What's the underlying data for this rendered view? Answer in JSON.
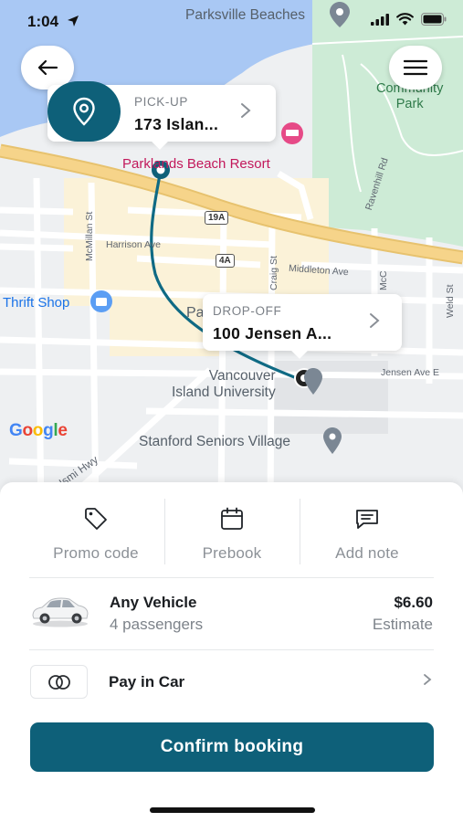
{
  "status_bar": {
    "time": "1:04"
  },
  "map": {
    "labels": {
      "parksville_beaches": "Parksville Beaches",
      "community_park": "lle\nCommunity\nPark",
      "resort": "Parklands Beach Resort",
      "thrift_shop": "Thrift Shop",
      "harrison_ave": "Harrison Ave",
      "middleton_ave": "Middleton Ave",
      "ravenhill_rd": "Ravenhill Rd",
      "mcmillan_st": "McMillan St",
      "craig_st": "Craig St",
      "mcc": "McC",
      "weld_st": "Weld St",
      "jensen_ave_e": "Jensen Ave E",
      "university": "Vancouver\nIsland University",
      "seniors_village": "Stanford Seniors Village",
      "hwy": "Ismi Hwy",
      "partial_pa": "Pa",
      "partial_v": "V"
    },
    "shields": {
      "h19a": "19A",
      "h4a": "4A"
    },
    "google": [
      "G",
      "o",
      "o",
      "g",
      "l",
      "e"
    ]
  },
  "pickup": {
    "caption": "PICK-UP",
    "address": "173 Islan..."
  },
  "dropoff": {
    "caption": "DROP-OFF",
    "address": "100 Jensen A..."
  },
  "options": {
    "promo": "Promo code",
    "prebook": "Prebook",
    "note": "Add note"
  },
  "vehicle": {
    "name": "Any Vehicle",
    "passengers": "4 passengers",
    "price": "$6.60",
    "price_label": "Estimate"
  },
  "payment": {
    "label": "Pay in Car"
  },
  "confirm": {
    "label": "Confirm booking"
  },
  "colors": {
    "accent": "#0e6079",
    "route": "#0f6a84",
    "water": "#a9c8f4",
    "park": "#cdebd6",
    "highway": "#f6d48a"
  },
  "icons": [
    "location-arrow-icon",
    "signal-icon",
    "wifi-icon",
    "battery-icon",
    "back-arrow-icon",
    "hamburger-menu-icon",
    "location-pin-icon",
    "chevron-right-icon",
    "tag-icon",
    "calendar-icon",
    "message-icon",
    "car-icon",
    "credit-card-icon"
  ]
}
